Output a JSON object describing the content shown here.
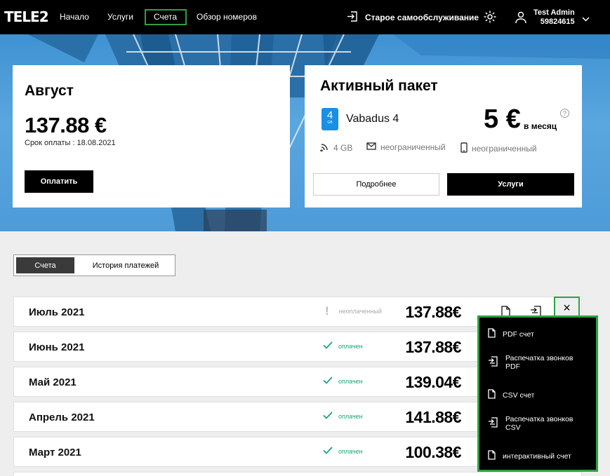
{
  "nav": {
    "logo": "TELE2",
    "links": [
      "Начало",
      "Услуги",
      "Счета",
      "Обзор номеров"
    ],
    "active": "Счета",
    "old_self_service": "Старое самообслуживание",
    "user_name": "Test Admin",
    "user_number": "59824615"
  },
  "current_bill": {
    "month": "Август",
    "amount": "137.88 €",
    "due_date": "Срок оплаты : 18.08.2021",
    "pay_label": "Оплатить"
  },
  "package": {
    "title": "Активный пакет",
    "icon_number": "4",
    "icon_unit": "GB",
    "name": "Vabadus 4",
    "price": "5 €",
    "price_unit": "в месяц",
    "help": "?",
    "features": {
      "data": "4 GB",
      "sms": "неограниченный",
      "calls": "неограниченный"
    },
    "more_label": "Подробнее",
    "services_label": "Услуги"
  },
  "tabs": {
    "bills": "Счета",
    "history": "История платежей"
  },
  "bills": [
    {
      "month": "Июль 2021",
      "status": "неоплаченный",
      "paid": false,
      "amount": "137.88€"
    },
    {
      "month": "Июнь 2021",
      "status": "оплачен",
      "paid": true,
      "amount": "137.88€"
    },
    {
      "month": "Май 2021",
      "status": "оплачен",
      "paid": true,
      "amount": "139.04€"
    },
    {
      "month": "Апрель 2021",
      "status": "оплачен",
      "paid": true,
      "amount": "141.88€"
    },
    {
      "month": "Март 2021",
      "status": "оплачен",
      "paid": true,
      "amount": "100.38€"
    }
  ],
  "close_symbol": "×",
  "dropdown": [
    {
      "icon": "file-icon",
      "line1": "PDF счет",
      "line2": ""
    },
    {
      "icon": "export-icon",
      "line1": "Распечатка звонков",
      "line2": "PDF"
    },
    {
      "icon": "file-icon",
      "line1": "CSV счет",
      "line2": ""
    },
    {
      "icon": "export-icon",
      "line1": "Распечатка звонков",
      "line2": "CSV"
    },
    {
      "icon": "file-icon",
      "line1": "интерактивный счет",
      "line2": ""
    }
  ],
  "colors": {
    "accent_green": "#2ea043",
    "paid_green": "#1aa27a",
    "package_blue": "#1a8fe6"
  }
}
